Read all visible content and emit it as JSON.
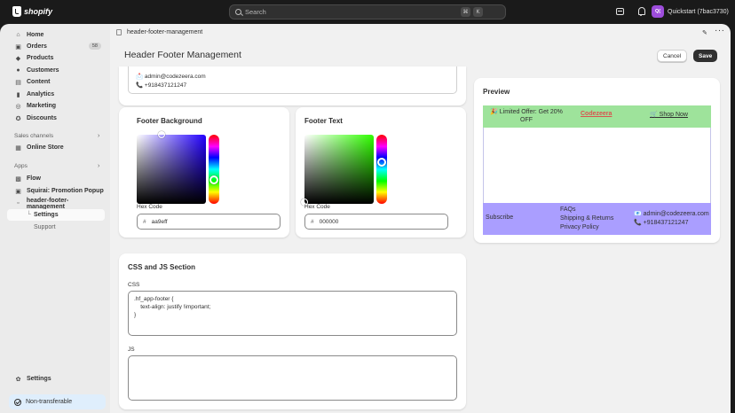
{
  "topbar": {
    "logo_text": "shopify",
    "search_placeholder": "Search",
    "shortcut_keys": [
      "⌘",
      "K"
    ],
    "store_initials": "Q(",
    "store_name": "Quickstart (7bac3730)"
  },
  "sidebar": {
    "items": [
      {
        "label": "Home",
        "icon": "home-icon"
      },
      {
        "label": "Orders",
        "icon": "orders-icon",
        "badge": "58"
      },
      {
        "label": "Products",
        "icon": "tag-icon"
      },
      {
        "label": "Customers",
        "icon": "person-icon"
      },
      {
        "label": "Content",
        "icon": "content-icon"
      },
      {
        "label": "Analytics",
        "icon": "bar-chart-icon"
      },
      {
        "label": "Marketing",
        "icon": "target-icon"
      },
      {
        "label": "Discounts",
        "icon": "discount-icon"
      }
    ],
    "sales_channels_label": "Sales channels",
    "online_store_label": "Online Store",
    "apps_label": "Apps",
    "apps": [
      "Flow",
      "Squirai: Promotion Popup",
      "header-footer-management"
    ],
    "app_sub": [
      "Settings",
      "Support"
    ],
    "settings_label": "Settings",
    "non_transferable_label": "Non-transferable"
  },
  "breadcrumb": "header-footer-management",
  "page": {
    "title": "Header Footer Management",
    "cancel_label": "Cancel",
    "save_label": "Save"
  },
  "contact": {
    "email": "📩 admin@codezeera.com",
    "phone": "📞 +918437121247"
  },
  "footer_background": {
    "title": "Footer Background",
    "hex_label": "Hex Code",
    "hash": "#",
    "value": "aa9eff",
    "hue_color": "#2200ff"
  },
  "footer_text": {
    "title": "Footer Text",
    "hex_label": "Hex Code",
    "hash": "#",
    "value": "000000",
    "hue_color": "#30ff00"
  },
  "css_js": {
    "title": "CSS and JS Section",
    "css_label": "CSS",
    "css_value": ".hf_app-footer {\n    text-align: justify !important;\n}",
    "js_label": "JS",
    "js_value": ""
  },
  "preview": {
    "title": "Preview",
    "offer": "🎉 Limited Offer: Get 20% OFF",
    "brand": "Codezeera",
    "shop": "🛒 Shop Now",
    "subscribe": "Subscribe",
    "links": [
      "FAQs",
      "Shipping & Returns",
      "Privacy Policy"
    ],
    "email": "📧 admin@codezeera.com",
    "phone": "📞 +918437121247",
    "header_bg": "#9ee39b",
    "footer_bg": "#aa9eff"
  }
}
